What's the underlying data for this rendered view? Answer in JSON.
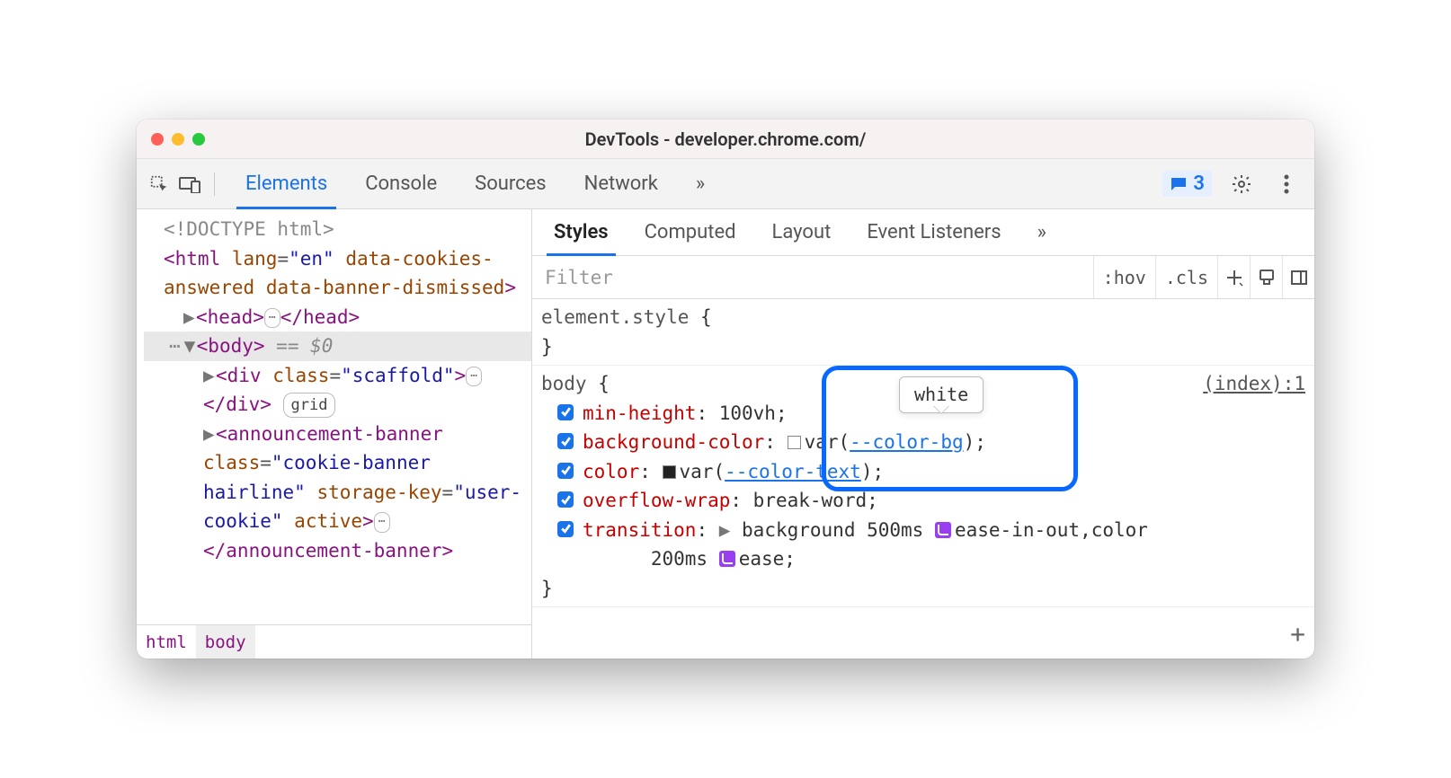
{
  "window": {
    "title": "DevTools - developer.chrome.com/"
  },
  "toolbar": {
    "tabs": [
      "Elements",
      "Console",
      "Sources",
      "Network"
    ],
    "active_tab": "Elements",
    "overflow": "»",
    "issues_count": "3"
  },
  "dom": {
    "doctype": "<!DOCTYPE html>",
    "html_open": "<html lang=\"en\" data-cookies-answered data-banner-dismissed>",
    "head": {
      "open": "<head>",
      "close": "</head>"
    },
    "body_row": {
      "open": "<body>",
      "selected_marker": "== $0"
    },
    "scaffold": {
      "open": "<div class=\"scaffold\">",
      "close": "</div>",
      "badge": "grid"
    },
    "announcement": "<announcement-banner class=\"cookie-banner hairline\" storage-key=\"user-cookie\" active>…</announcement-banner>"
  },
  "breadcrumb": {
    "items": [
      "html",
      "body"
    ],
    "active": "body"
  },
  "styles": {
    "subtabs": [
      "Styles",
      "Computed",
      "Layout",
      "Event Listeners"
    ],
    "active_subtab": "Styles",
    "overflow": "»",
    "filter_placeholder": "Filter",
    "hov": ":hov",
    "cls": ".cls",
    "element_style": {
      "selector": "element.style",
      "open": "{",
      "close": "}"
    },
    "body_rule": {
      "selector": "body",
      "open": "{",
      "close": "}",
      "source": "(index):1",
      "decls": {
        "min_height": {
          "prop": "min-height",
          "val": "100vh;"
        },
        "bg": {
          "prop": "background-color",
          "val_prefix": "var(",
          "var": "--color-bg",
          "val_suffix": ");"
        },
        "color": {
          "prop": "color",
          "val_prefix": "var(",
          "var": "--color-text",
          "val_suffix": ");"
        },
        "overflow_wrap": {
          "prop": "overflow-wrap",
          "val": "break-word;"
        },
        "transition": {
          "prop": "transition",
          "part1": "background 500ms",
          "bez1": "ease-in-out",
          "mid": ",color",
          "part2": "200ms",
          "bez2": "ease;"
        }
      }
    },
    "tooltip": "white"
  }
}
